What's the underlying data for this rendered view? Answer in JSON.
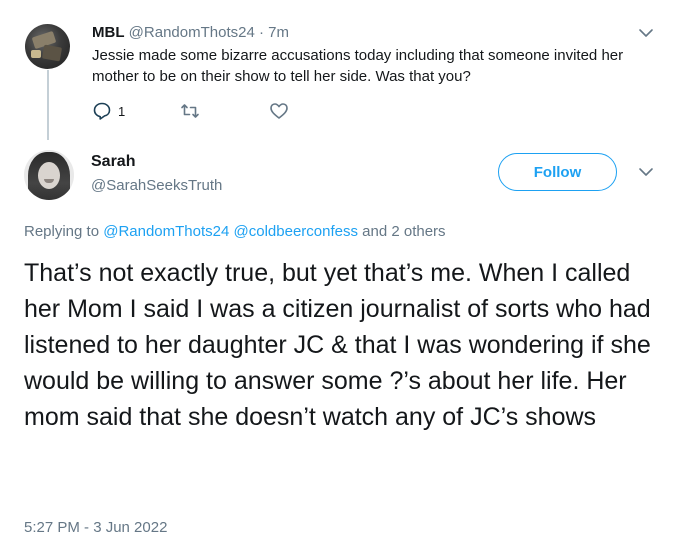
{
  "parent_tweet": {
    "display_name": "MBL",
    "handle": "@RandomThots24",
    "separator": "·",
    "time": "7m",
    "text": "Jessie made some bizarre accusations today including that someone invited her mother to be on their show to tell her side.  Was that you?",
    "reply_count": "1",
    "icons": [
      "reply-icon",
      "retweet-icon",
      "like-icon",
      "chevron-down-icon"
    ]
  },
  "main_tweet": {
    "display_name": "Sarah",
    "handle": "@SarahSeeksTruth",
    "follow_label": "Follow",
    "replying_prefix": "Replying to",
    "replying_mention_1": "@RandomThots24",
    "replying_mention_2": "@coldbeerconfess",
    "replying_suffix": "and 2 others",
    "text": "That’s not exactly true, but yet that’s me. When I called her Mom I said I was a citizen journalist of sorts who had listened to her daughter JC & that I was wondering if she would be willing to answer some ?’s about her life. Her mom said that she doesn’t watch any of JC’s shows",
    "timestamp": "5:27 PM - 3 Jun 2022"
  },
  "colors": {
    "accent": "#1da1f2",
    "secondary_text": "#657786",
    "primary_text": "#14171a",
    "thread_line": "#c4cfd6"
  }
}
